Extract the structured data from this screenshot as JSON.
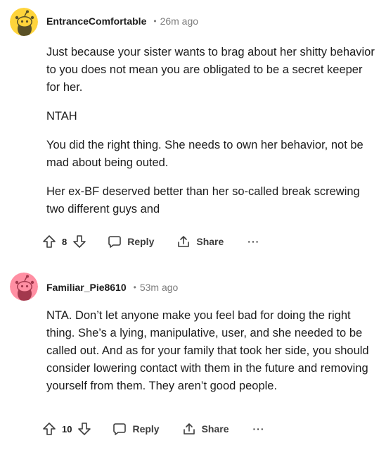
{
  "comments": [
    {
      "username": "EntranceComfortable",
      "time": "26m ago",
      "avatar_color": "#ffd43b",
      "paragraphs": [
        "Just because your sister wants to brag about her shitty behavior to you does not mean you are obligated to be a secret keeper for her.",
        "NTAH",
        "You did the right thing. She needs to own her behavior, not be mad about being outed.",
        "Her ex-BF deserved better than her so-called break screwing two different guys and"
      ],
      "votes": "8",
      "reply_label": "Reply",
      "share_label": "Share",
      "more_label": "···"
    },
    {
      "username": "Familiar_Pie8610",
      "time": "53m ago",
      "avatar_color": "#ff8fa3",
      "paragraphs": [
        "NTA. Don’t let anyone make you feel bad for doing the right thing. She’s a lying, manipulative, user, and she needed to be called out. And as for your family that took her side, you should consider lowering contact with them in the future and removing yourself from them. They aren’t good people."
      ],
      "votes": "10",
      "reply_label": "Reply",
      "share_label": "Share",
      "more_label": "···"
    }
  ],
  "icons": {
    "upvote": "upvote-arrow-icon",
    "downvote": "downvote-arrow-icon",
    "reply": "speech-bubble-icon",
    "share": "share-arrow-icon",
    "avatar": "snoo-avatar-icon"
  }
}
